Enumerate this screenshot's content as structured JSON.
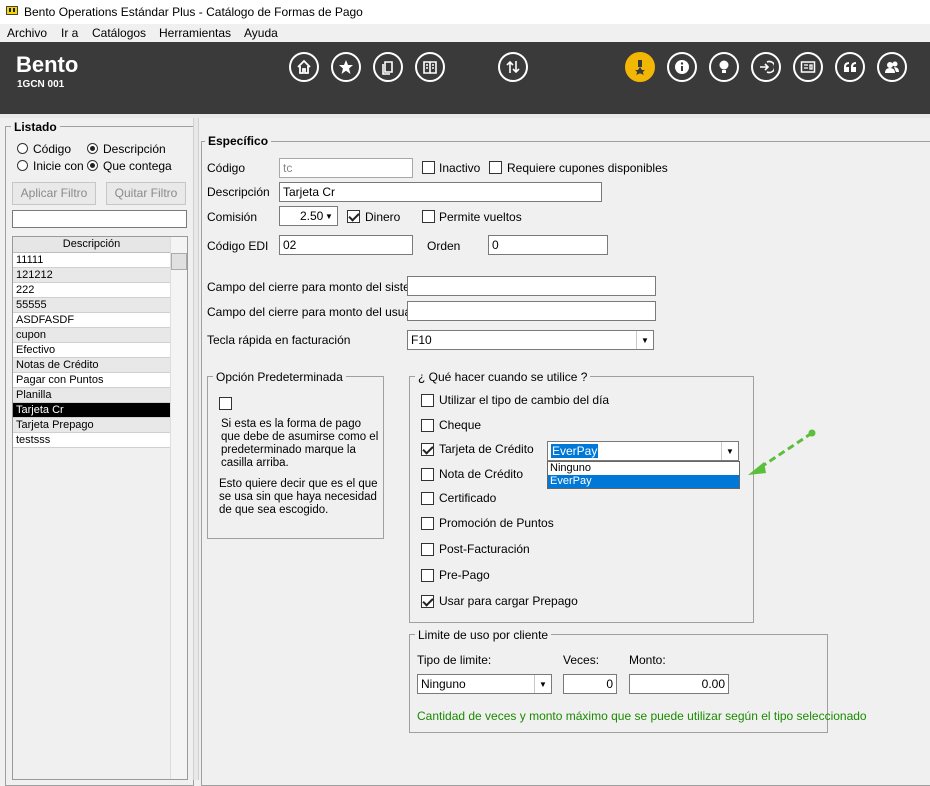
{
  "window": {
    "title": "Bento Operations Estándar Plus - Catálogo de Formas de Pago"
  },
  "menu": [
    "Archivo",
    "Ir a",
    "Catálogos",
    "Herramientas",
    "Ayuda"
  ],
  "header": {
    "brand": "Bento",
    "code": "1GCN 001",
    "icons": [
      "home-icon",
      "star-icon",
      "copy-icon",
      "ledger-icon",
      "sort-arrows-icon",
      "award-icon",
      "info-icon",
      "bulb-icon",
      "logout-icon",
      "id-card-icon",
      "quote-icon",
      "users-icon"
    ],
    "accent": "#f2b705"
  },
  "listado": {
    "legend": "Listado",
    "radios": {
      "codigo": "Código",
      "descripcion": "Descripción",
      "inicie_con": "Inicie con",
      "que_contega": "Que contega"
    },
    "aplicar_filtro": "Aplicar Filtro",
    "quitar_filtro": "Quitar Filtro",
    "filter_value": "",
    "column_header": "Descripción",
    "items": [
      "11111",
      "121212",
      "222",
      "55555",
      "ASDFASDF",
      "cupon",
      "Efectivo",
      "Notas de Crédito",
      "Pagar con Puntos",
      "Planilla",
      "Tarjeta Cr",
      "Tarjeta Prepago",
      "testsss"
    ],
    "selected": "Tarjeta Cr"
  },
  "especifico": {
    "legend": "Específico",
    "codigo_label": "Código",
    "codigo_value": "tc",
    "inactivo": "Inactivo",
    "requiere_cupones": "Requiere cupones disponibles",
    "descripcion_label": "Descripción",
    "descripcion_value": "Tarjeta Cr",
    "comision_label": "Comisión",
    "comision_value": "2.50",
    "dinero": "Dinero",
    "permite_vueltos": "Permite vueltos",
    "codigo_edi_label": "Código EDI",
    "codigo_edi_value": "02",
    "orden_label": "Orden",
    "orden_value": "0",
    "cierre_sistema_label": "Campo del cierre para monto del sistema",
    "cierre_usuario_label": "Campo del cierre para monto del usuario",
    "tecla_label": "Tecla rápida en facturación",
    "tecla_value": "F10"
  },
  "opcion": {
    "legend": "Opción Predeterminada",
    "text1": "Si esta es la forma de pago que debe de asumirse como el predeterminado marque la casilla arriba.",
    "text2": "Esto quiere decir que es el que se usa sin que haya necesidad de que sea escogido."
  },
  "que_hacer": {
    "legend": "¿ Qué hacer cuando se utilice ?",
    "options": [
      "Utilizar el tipo de cambio del día",
      "Cheque",
      "Tarjeta de Crédito",
      "Nota de Crédito",
      "Certificado",
      "Promoción de Puntos",
      "Post-Facturación",
      "Pre-Pago",
      "Usar para cargar Prepago"
    ],
    "card_value": "EverPay",
    "card_options": [
      "Ninguno",
      "EverPay"
    ]
  },
  "limite": {
    "legend": "Limite de uso por cliente",
    "tipo_label": "Tipo de limite:",
    "tipo_value": "Ninguno",
    "veces_label": "Veces:",
    "veces_value": "0",
    "monto_label": "Monto:",
    "monto_value": "0.00",
    "note": "Cantidad de veces y monto máximo que se puede utilizar según el tipo seleccionado"
  }
}
